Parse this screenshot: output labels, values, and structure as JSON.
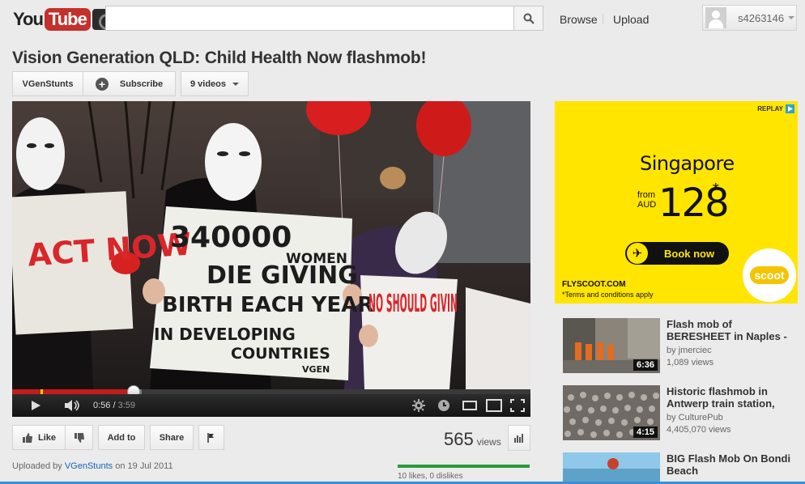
{
  "header": {
    "logo_you": "You",
    "logo_tube": "Tube",
    "search_placeholder": "",
    "nav": {
      "browse": "Browse",
      "upload": "Upload"
    },
    "username": "s4263146"
  },
  "video": {
    "title": "Vision Generation QLD: Child Health Now flashmob!",
    "channel": "VGenStunts",
    "subscribe_label": "Subscribe",
    "videos_label": "9 videos",
    "current_time": "0:56",
    "duration": "3:59",
    "progress_fraction": 0.234,
    "sign_texts": {
      "left_sign": "ACT NOW",
      "main_sign_line1": "340000",
      "main_sign_line2": "WOMEN",
      "main_sign_line3": "DIE GIVING",
      "main_sign_line4": "BIRTH EACH YEAR",
      "main_sign_line5": "IN DEVELOPING",
      "main_sign_line6": "COUNTRIES",
      "main_sign_tag": "VGEN",
      "right_sign": "NO SHOULD GIVIN"
    }
  },
  "actions": {
    "like": "Like",
    "add_to": "Add to",
    "share": "Share",
    "view_count": "565",
    "views_label": "views",
    "likes_text": "10 likes, 0 dislikes",
    "uploaded_by_prefix": "Uploaded by",
    "uploaded_by": "VGenStunts",
    "uploaded_on": "on 19 Jul 2011"
  },
  "ad": {
    "replay": "REPLAY",
    "city": "Singapore",
    "from": "from",
    "currency": "AUD",
    "price": "128",
    "star": "*",
    "book": "Book now",
    "url": "FLYSCOOT.COM",
    "terms": "*Terms and conditions apply",
    "brand": "scoot"
  },
  "related": [
    {
      "title": "Flash mob of BERESHEET in Naples -",
      "by": "by jmerciec",
      "views": "1,089 views",
      "duration": "6:36"
    },
    {
      "title": "Historic flashmob in Antwerp train station,",
      "by": "by CulturePub",
      "views": "4,405,070 views",
      "duration": "4:15"
    },
    {
      "title": "BIG Flash Mob On Bondi Beach",
      "by": "",
      "views": "",
      "duration": ""
    }
  ],
  "colors": {
    "accent_red": "#c4302b",
    "link_blue": "#1c62b9",
    "ad_yellow": "#ffe500",
    "like_green": "#2b9a3b"
  }
}
